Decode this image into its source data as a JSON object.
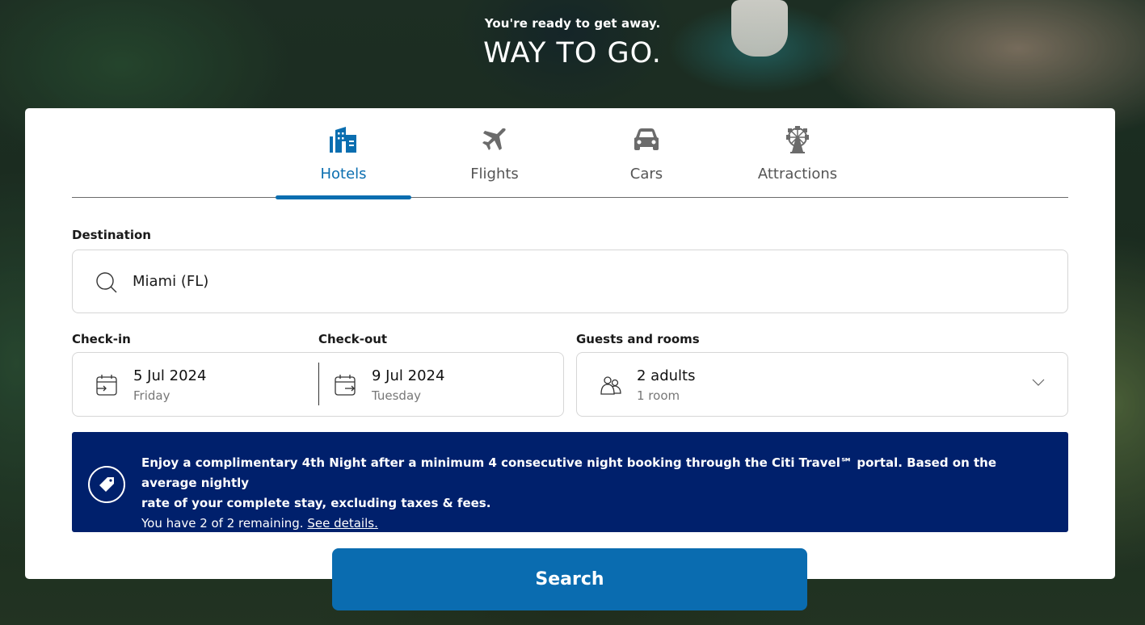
{
  "hero": {
    "subtitle": "You're ready to get away.",
    "title": "WAY TO GO."
  },
  "tabs": [
    {
      "label": "Hotels",
      "icon": "hotel-icon",
      "active": true
    },
    {
      "label": "Flights",
      "icon": "airplane-icon",
      "active": false
    },
    {
      "label": "Cars",
      "icon": "car-icon",
      "active": false
    },
    {
      "label": "Attractions",
      "icon": "ferris-wheel-icon",
      "active": false
    }
  ],
  "destination": {
    "label": "Destination",
    "value": "Miami (FL)",
    "icon": "search-icon"
  },
  "checkin": {
    "label": "Check-in",
    "date": "5 Jul 2024",
    "day": "Friday",
    "icon": "calendar-checkin-icon"
  },
  "checkout": {
    "label": "Check-out",
    "date": "9 Jul 2024",
    "day": "Tuesday",
    "icon": "calendar-checkout-icon"
  },
  "guests": {
    "label": "Guests and rooms",
    "adults": "2 adults",
    "rooms": "1 room",
    "icon": "people-icon"
  },
  "promo": {
    "icon": "tag-icon",
    "line1": "Enjoy a complimentary 4th Night after a minimum 4 consecutive night booking through the Citi Travel℠ portal. Based on the average nightly",
    "line2": "rate of your complete stay, excluding taxes & fees.",
    "line3": "You have 2 of 2 remaining.",
    "link": "See details."
  },
  "search_button": {
    "label": "Search"
  },
  "colors": {
    "accent": "#0a6eb0",
    "promo_bg": "#00206c",
    "tab_inactive": "#6b6b6b"
  }
}
